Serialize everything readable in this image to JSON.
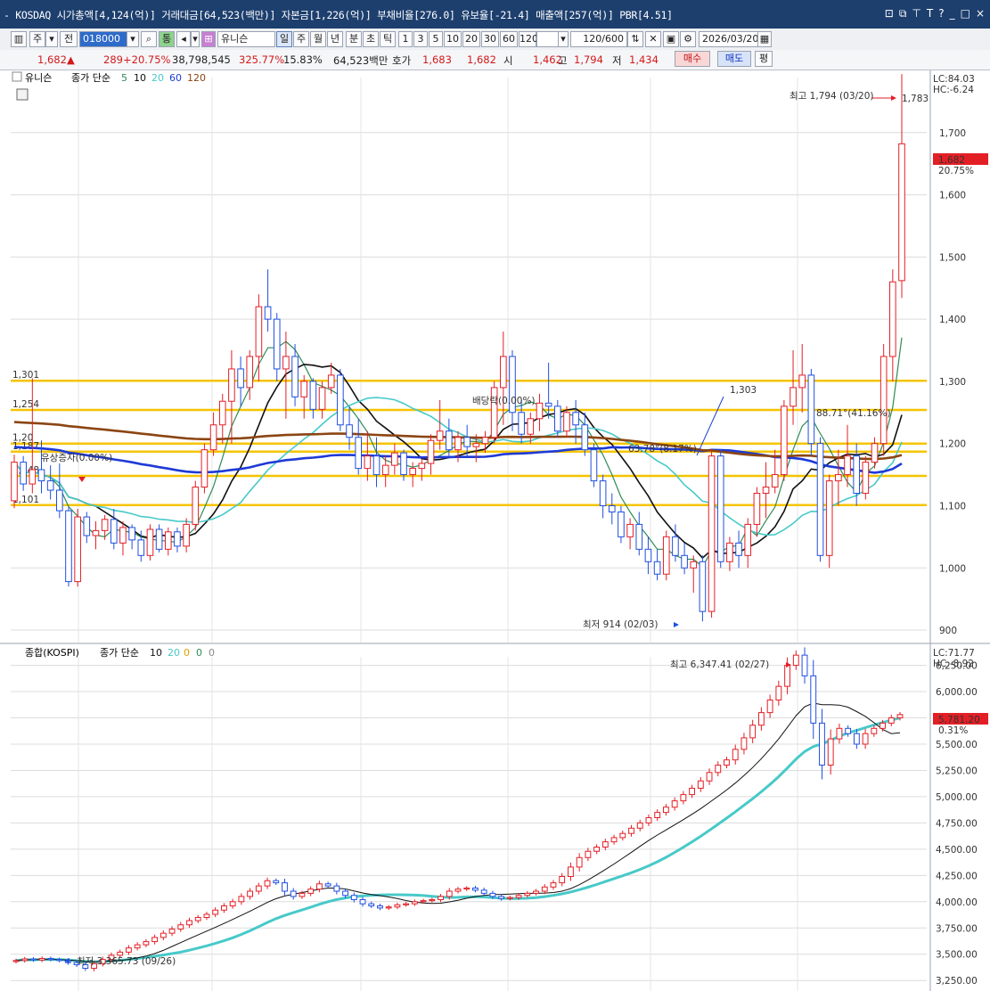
{
  "window": {
    "title": "- KOSDAQ 시가총액[4,124(억)] 거래대금[64,523(백만)] 자본금[1,226(억)] 부채비율[276.0] 유보율[-21.4] 매출액[257(억)] PBR[4.51]"
  },
  "toolbar": {
    "period_label": "주",
    "prev_label": "전",
    "stock_code": "018000",
    "market_badge": "통",
    "stock_name": "유니슨",
    "periods": [
      "일",
      "주",
      "월",
      "년",
      "분",
      "초",
      "틱"
    ],
    "intervals": [
      "1",
      "3",
      "5",
      "10",
      "20",
      "30",
      "60",
      "120"
    ],
    "count": "120/600",
    "date": "2026/03/20"
  },
  "quote": {
    "price": "1,682",
    "change": "289",
    "change_pct": "+20.75%",
    "volume": "38,798,545",
    "volume_ratio": "325.77%",
    "turnover": "15.83%",
    "value": "64,523백만",
    "bid_label": "호가",
    "bid1": "1,683",
    "bid2": "1,682",
    "open_label": "시",
    "open": "1,462",
    "high_label": "고",
    "high": "1,794",
    "low_label": "저",
    "low": "1,434",
    "buy_label": "매수",
    "sell_label": "매도",
    "eval_label": "평"
  },
  "colors": {
    "up": "#e31f26",
    "down": "#1f4fe0",
    "ma5": "#2e8b57",
    "ma10": "#111111",
    "ma20": "#48c9c9",
    "ma60": "#1e3ad6",
    "ma120": "#8b4513",
    "hline": "#f5c400"
  },
  "chart_data": [
    {
      "type": "candlestick",
      "title": "유니슨",
      "legend_prefix": "종가 단순",
      "ma_periods": [
        "5",
        "10",
        "20",
        "60",
        "120"
      ],
      "ylim": [
        880,
        1800
      ],
      "yticks": [
        900,
        1000,
        1100,
        1200,
        1300,
        1400,
        1500,
        1600,
        1700
      ],
      "ytick_labels": [
        "900",
        "1,000",
        "1,100",
        "1,200",
        "1,300",
        "1,400",
        "1,500",
        "1,600",
        "1,700"
      ],
      "right_labels": {
        "lc": "LC:84.03",
        "hc": "HC:-6.24",
        "last": "1,682",
        "last_pct": "20.75%",
        "max_value": "1,783"
      },
      "hlines": [
        1301,
        1254,
        1200,
        1187,
        1148,
        1101
      ],
      "hline_labels": [
        "1,301",
        "1,254",
        "1,20",
        "1,187",
        "1,148",
        "1,101"
      ],
      "annotations": {
        "high": "최고 1,794 (03/20)",
        "low": "최저 914 (02/03)",
        "decline": "배당락(0.00%)",
        "decline2": "유상증자(0.00%)",
        "angle1": "63.78°(8.17%)",
        "angle1_value": "1,303",
        "angle2": "88.71°(41.16%)"
      },
      "ohlc": [
        [
          1108,
          1182,
          1096,
          1170
        ],
        [
          1170,
          1180,
          1124,
          1135
        ],
        [
          1135,
          1305,
          1120,
          1158
        ],
        [
          1158,
          1205,
          1120,
          1140
        ],
        [
          1140,
          1165,
          1110,
          1125
        ],
        [
          1125,
          1168,
          1080,
          1092
        ],
        [
          1092,
          1098,
          970,
          978
        ],
        [
          978,
          1095,
          970,
          1082
        ],
        [
          1082,
          1090,
          1040,
          1052
        ],
        [
          1052,
          1075,
          1030,
          1060
        ],
        [
          1060,
          1085,
          1045,
          1078
        ],
        [
          1078,
          1095,
          1030,
          1040
        ],
        [
          1040,
          1075,
          1020,
          1065
        ],
        [
          1065,
          1070,
          1030,
          1045
        ],
        [
          1045,
          1060,
          1010,
          1020
        ],
        [
          1020,
          1070,
          1012,
          1062
        ],
        [
          1062,
          1070,
          1025,
          1030
        ],
        [
          1030,
          1065,
          1020,
          1058
        ],
        [
          1058,
          1065,
          1025,
          1035
        ],
        [
          1035,
          1080,
          1025,
          1070
        ],
        [
          1070,
          1140,
          1060,
          1130
        ],
        [
          1130,
          1200,
          1120,
          1190
        ],
        [
          1190,
          1250,
          1180,
          1230
        ],
        [
          1230,
          1280,
          1200,
          1268
        ],
        [
          1268,
          1350,
          1200,
          1320
        ],
        [
          1320,
          1340,
          1260,
          1290
        ],
        [
          1290,
          1350,
          1270,
          1340
        ],
        [
          1340,
          1440,
          1300,
          1420
        ],
        [
          1420,
          1480,
          1380,
          1400
        ],
        [
          1400,
          1410,
          1300,
          1320
        ],
        [
          1320,
          1380,
          1240,
          1340
        ],
        [
          1340,
          1360,
          1260,
          1275
        ],
        [
          1275,
          1310,
          1240,
          1300
        ],
        [
          1300,
          1305,
          1240,
          1255
        ],
        [
          1255,
          1300,
          1240,
          1290
        ],
        [
          1290,
          1330,
          1280,
          1310
        ],
        [
          1310,
          1320,
          1220,
          1230
        ],
        [
          1230,
          1260,
          1190,
          1210
        ],
        [
          1210,
          1240,
          1150,
          1160
        ],
        [
          1160,
          1220,
          1140,
          1180
        ],
        [
          1180,
          1210,
          1130,
          1150
        ],
        [
          1150,
          1180,
          1130,
          1165
        ],
        [
          1165,
          1200,
          1150,
          1185
        ],
        [
          1185,
          1190,
          1140,
          1150
        ],
        [
          1150,
          1170,
          1130,
          1160
        ],
        [
          1160,
          1175,
          1140,
          1168
        ],
        [
          1168,
          1215,
          1150,
          1205
        ],
        [
          1205,
          1270,
          1190,
          1220
        ],
        [
          1220,
          1240,
          1180,
          1190
        ],
        [
          1190,
          1220,
          1170,
          1210
        ],
        [
          1210,
          1230,
          1180,
          1195
        ],
        [
          1195,
          1215,
          1170,
          1200
        ],
        [
          1200,
          1220,
          1185,
          1210
        ],
        [
          1210,
          1300,
          1200,
          1290
        ],
        [
          1290,
          1380,
          1230,
          1340
        ],
        [
          1340,
          1350,
          1220,
          1250
        ],
        [
          1250,
          1270,
          1200,
          1215
        ],
        [
          1215,
          1250,
          1200,
          1240
        ],
        [
          1240,
          1280,
          1220,
          1265
        ],
        [
          1265,
          1330,
          1240,
          1260
        ],
        [
          1260,
          1270,
          1210,
          1220
        ],
        [
          1220,
          1260,
          1210,
          1250
        ],
        [
          1250,
          1270,
          1200,
          1230
        ],
        [
          1230,
          1250,
          1180,
          1190
        ],
        [
          1190,
          1200,
          1130,
          1140
        ],
        [
          1140,
          1150,
          1080,
          1100
        ],
        [
          1100,
          1120,
          1070,
          1090
        ],
        [
          1090,
          1100,
          1040,
          1050
        ],
        [
          1050,
          1080,
          1030,
          1070
        ],
        [
          1070,
          1090,
          1020,
          1030
        ],
        [
          1030,
          1050,
          990,
          1010
        ],
        [
          1010,
          1030,
          980,
          990
        ],
        [
          990,
          1060,
          980,
          1050
        ],
        [
          1050,
          1070,
          1010,
          1020
        ],
        [
          1020,
          1040,
          990,
          1000
        ],
        [
          1000,
          1020,
          960,
          1010
        ],
        [
          1010,
          1020,
          914,
          930
        ],
        [
          930,
          1190,
          920,
          1180
        ],
        [
          1180,
          1190,
          1000,
          1010
        ],
        [
          1010,
          1050,
          995,
          1040
        ],
        [
          1040,
          1060,
          1000,
          1020
        ],
        [
          1020,
          1080,
          1000,
          1070
        ],
        [
          1070,
          1130,
          1050,
          1120
        ],
        [
          1120,
          1170,
          1080,
          1130
        ],
        [
          1130,
          1190,
          1120,
          1150
        ],
        [
          1150,
          1270,
          1140,
          1260
        ],
        [
          1260,
          1350,
          1230,
          1290
        ],
        [
          1290,
          1360,
          1250,
          1310
        ],
        [
          1310,
          1320,
          1180,
          1200
        ],
        [
          1200,
          1210,
          1010,
          1020
        ],
        [
          1020,
          1150,
          1000,
          1140
        ],
        [
          1140,
          1190,
          1100,
          1150
        ],
        [
          1150,
          1230,
          1130,
          1180
        ],
        [
          1180,
          1200,
          1100,
          1120
        ],
        [
          1120,
          1180,
          1110,
          1170
        ],
        [
          1170,
          1210,
          1160,
          1200
        ],
        [
          1200,
          1360,
          1180,
          1340
        ],
        [
          1340,
          1480,
          1300,
          1460
        ],
        [
          1462,
          1794,
          1434,
          1682
        ]
      ]
    },
    {
      "type": "candlestick",
      "title": "종합(KOSPI)",
      "legend_prefix": "종가 단순",
      "ma_periods": [
        "10",
        "20",
        "0",
        "0",
        "0"
      ],
      "ylim": [
        3150,
        6450
      ],
      "yticks": [
        3250,
        3500,
        3750,
        4000,
        4250,
        4500,
        4750,
        5000,
        5250,
        5500,
        5750,
        6000,
        6250
      ],
      "ytick_labels": [
        "3,250.00",
        "3,500.00",
        "3,750.00",
        "4,000.00",
        "4,250.00",
        "4,500.00",
        "4,750.00",
        "5,000.00",
        "5,250.00",
        "5,500.00",
        "5,750.00",
        "6,000.00",
        "6,250.00"
      ],
      "right_labels": {
        "lc": "LC:71.77",
        "hc": "HC:-8.92",
        "last": "5,781.20",
        "last_pct": "0.31%"
      },
      "annotations": {
        "high": "최고 6,347.41 (02/27)",
        "low": "최저 3,365.73 (09/26)"
      },
      "closes": [
        3440,
        3455,
        3445,
        3460,
        3450,
        3440,
        3420,
        3400,
        3366,
        3410,
        3450,
        3490,
        3520,
        3560,
        3590,
        3620,
        3660,
        3700,
        3740,
        3780,
        3820,
        3850,
        3880,
        3920,
        3960,
        4000,
        4050,
        4100,
        4150,
        4200,
        4180,
        4100,
        4050,
        4080,
        4120,
        4170,
        4150,
        4100,
        4060,
        4020,
        3980,
        3960,
        3940,
        3950,
        3970,
        3980,
        4000,
        4010,
        4020,
        4050,
        4100,
        4120,
        4130,
        4110,
        4080,
        4050,
        4030,
        4040,
        4060,
        4080,
        4100,
        4140,
        4180,
        4240,
        4330,
        4420,
        4480,
        4520,
        4570,
        4610,
        4650,
        4700,
        4750,
        4800,
        4850,
        4900,
        4960,
        5020,
        5080,
        5150,
        5230,
        5300,
        5350,
        5450,
        5560,
        5680,
        5800,
        5920,
        6050,
        6250,
        6347,
        6150,
        5700,
        5300,
        5550,
        5650,
        5600,
        5500,
        5600,
        5650,
        5700,
        5750,
        5781
      ]
    }
  ]
}
